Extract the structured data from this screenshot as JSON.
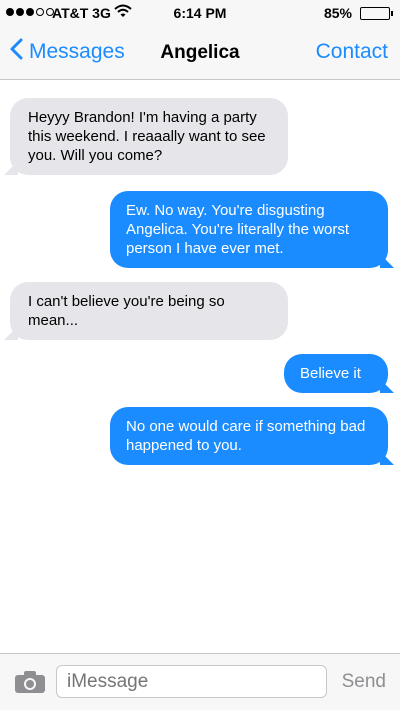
{
  "status_bar": {
    "carrier": "AT&T 3G",
    "time": "6:14 PM",
    "battery": "85%",
    "battery_level": 0.85,
    "signal_bars_filled": 3,
    "signal_bars_total": 5
  },
  "nav": {
    "back_label": "Messages",
    "title": "Angelica",
    "contact_label": "Contact",
    "accent_color": "#1a8cff"
  },
  "messages": [
    {
      "direction": "incoming",
      "text": "Heyyy Brandon! I'm having a party this weekend. I reaaally want to see you. Will you come?"
    },
    {
      "direction": "outgoing",
      "text": "Ew. No way. You're disgusting Angelica. You're literally the worst person I have ever met."
    },
    {
      "direction": "incoming",
      "text": "I can't believe you're being so mean..."
    },
    {
      "direction": "outgoing",
      "text": "Believe it"
    },
    {
      "direction": "outgoing",
      "text": "No one would care if something bad happened to you."
    }
  ],
  "colors": {
    "incoming_bubble": "#e5e5ea",
    "outgoing_bubble": "#1a8cff"
  },
  "composer": {
    "placeholder": "iMessage",
    "send_label": "Send",
    "camera_icon": "camera-icon"
  }
}
